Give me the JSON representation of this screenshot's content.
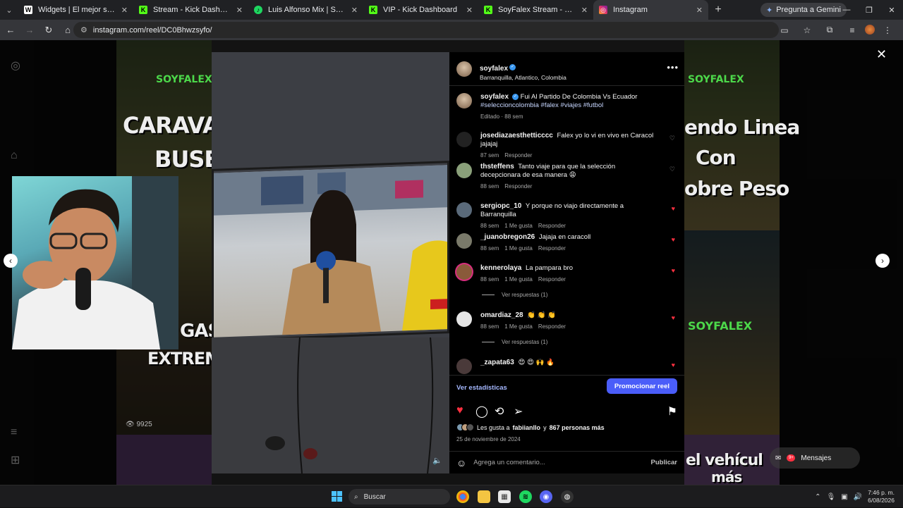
{
  "browser": {
    "tabs": [
      {
        "title": "Widgets | El mejor software para",
        "favicon": "W",
        "color": "#ffffff"
      },
      {
        "title": "Stream - Kick Dashboard",
        "favicon": "K",
        "color": "#53fc18"
      },
      {
        "title": "Luis Alfonso Mix | Spotify Playlist",
        "favicon": "♪",
        "color": "#1ed760"
      },
      {
        "title": "VIP - Kick Dashboard",
        "favicon": "K",
        "color": "#53fc18"
      },
      {
        "title": "SoyFalex Stream - Watch Live o",
        "favicon": "K",
        "color": "#53fc18"
      },
      {
        "title": "Instagram",
        "favicon": "◎",
        "color": "#e1306c",
        "active": true
      }
    ],
    "gemini_label": "Pregunta a Gemini",
    "url": "instagram.com/reel/DC0Bhwzsyfo/"
  },
  "background": {
    "text_caravana": "CARAVANA",
    "text_buses": "BUSES",
    "text_gas": "GAS",
    "text_extremas": "EXTREMAS",
    "text_endo": "endo Linea",
    "text_con": "Con",
    "text_bre": "obre Peso",
    "text_vehiculo": "el vehícul",
    "text_mas": "más",
    "soyfalex": "SOYFALEX",
    "views": "9925"
  },
  "reel": {
    "author": "soyfalex",
    "location": "Barranquilla, Atlantico, Colombia",
    "caption": "Fui Al Partido De Colombia Vs Ecuador",
    "hashtags": "#seleccioncolombia #falex #viajes #futbol",
    "caption_meta": "Editado · 88 sem",
    "comments": [
      {
        "user": "josediazaesthetticccc",
        "text": "Falex yo lo vi en vivo en Caracol jajajaj",
        "time": "87 sem",
        "likes": "",
        "reply": "Responder",
        "liked": false
      },
      {
        "user": "thsteffens",
        "text": "Tanto viaje para que la selección decepcionara de esa manera 😩",
        "time": "88 sem",
        "likes": "",
        "reply": "Responder",
        "liked": false
      },
      {
        "user": "sergiopc_10",
        "text": "Y porque no viajo directamente a Barranquilla",
        "time": "88 sem",
        "likes": "1 Me gusta",
        "reply": "Responder",
        "liked": true
      },
      {
        "user": "_juanobregon26",
        "text": "Jajaja en caracoll",
        "time": "88 sem",
        "likes": "1 Me gusta",
        "reply": "Responder",
        "liked": true
      },
      {
        "user": "kennerolaya",
        "text": "La pampara bro",
        "time": "88 sem",
        "likes": "1 Me gusta",
        "reply": "Responder",
        "liked": true,
        "replies": "Ver respuestas (1)"
      },
      {
        "user": "omardiaz_28",
        "text": "👏 👏 👏",
        "time": "88 sem",
        "likes": "1 Me gusta",
        "reply": "Responder",
        "liked": true,
        "replies": "Ver respuestas (1)"
      },
      {
        "user": "_zapata63",
        "text": "😍 😍 🙌 🔥",
        "time": "",
        "likes": "",
        "reply": "",
        "liked": true
      }
    ],
    "stats_link": "Ver estadísticas",
    "promote_label": "Promocionar reel",
    "likes_text_prefix": "Les gusta a",
    "likes_user": "fabiianllo",
    "likes_text_mid": "y",
    "likes_count": "867 personas más",
    "date": "25 de noviembre de 2024",
    "comment_placeholder": "Agrega un comentario...",
    "publish_label": "Publicar"
  },
  "messages": {
    "label": "Mensajes",
    "badge": "9+"
  },
  "taskbar": {
    "search_label": "Buscar",
    "time": "7:46 p. m.",
    "date": "6/08/2026"
  }
}
